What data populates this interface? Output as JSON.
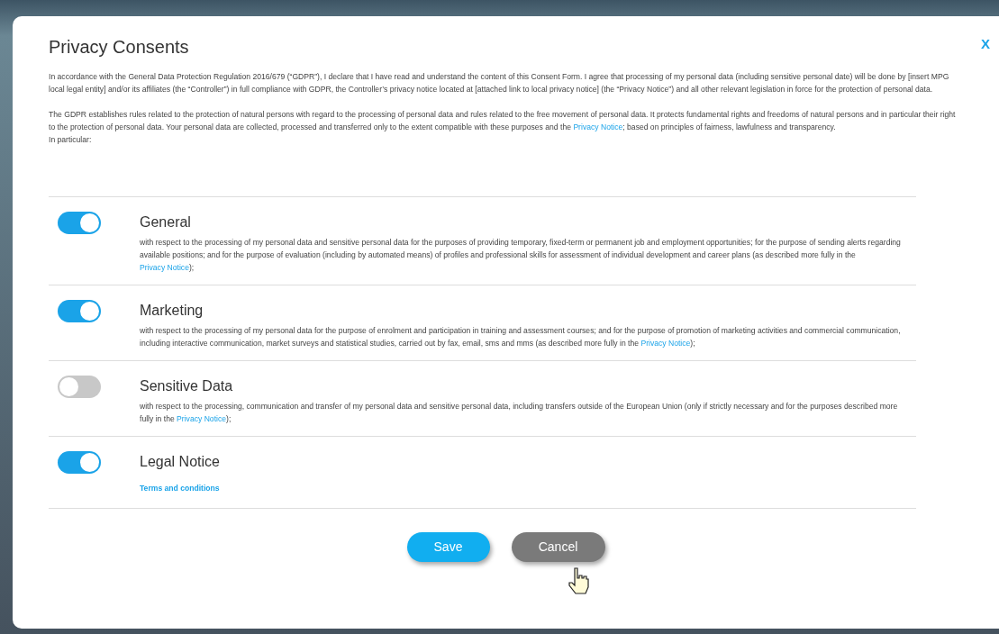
{
  "dialog": {
    "title": "Privacy Consents",
    "close": "X"
  },
  "intro": [
    {
      "before": "In accordance with the General Data Protection Regulation 2016/679 (“GDPR”), I declare that I have read and understand the content of this Consent Form.  I agree that processing of my personal data (including sensitive personal date) will be done by [insert MPG local legal entity] and/or its affiliates (the “Controller”) in full compliance with GDPR, the Controller’s privacy notice located at [attached link to local privacy notice] (the “Privacy Notice”) and all other relevant legislation in force for the protection of personal data."
    },
    {
      "before": "The GDPR establishes rules related to the protection of natural persons with regard to the processing of personal data and rules related to the free movement of personal data. It protects fundamental rights and freedoms of natural persons and in particular their right to the protection of personal data. Your personal data are collected, processed and transferred only to the extent compatible with these purposes and the ",
      "link": "Privacy Notice",
      "after": "; based on principles of fairness, lawfulness and transparency."
    }
  ],
  "intro_tail": "In particular:",
  "consents": [
    {
      "title": "General",
      "on": true,
      "before": "with respect to the processing of my personal data and sensitive personal data for the purposes of providing temporary, fixed-term or permanent job and employment opportunities; for the purpose of sending alerts regarding available positions; and for the purpose of evaluation (including by automated means) of profiles and professional skills for assessment of individual development and career plans (as described more fully in the ",
      "link": "Privacy Notice",
      "after": ");"
    },
    {
      "title": "Marketing",
      "on": true,
      "before": "with respect to the processing of my personal data for the purpose of enrolment and participation in training and assessment courses; and for the purpose of promotion of marketing activities and commercial communication, including interactive communication, market surveys and statistical studies, carried out by fax, email, sms and mms (as described more fully in the ",
      "link": "Privacy Notice",
      "after": ");"
    },
    {
      "title": "Sensitive Data",
      "on": false,
      "before": "with respect to the processing, communication and transfer of my personal data and sensitive personal data, including transfers outside of the European Union (only if strictly necessary and for the purposes described more fully in the ",
      "link": "Privacy Notice",
      "after": ");"
    },
    {
      "title": "Legal Notice",
      "on": true,
      "link": "Terms and conditions"
    }
  ],
  "buttons": [
    {
      "label": "Save",
      "kind": "primary"
    },
    {
      "label": "Cancel",
      "kind": "secondary"
    }
  ]
}
